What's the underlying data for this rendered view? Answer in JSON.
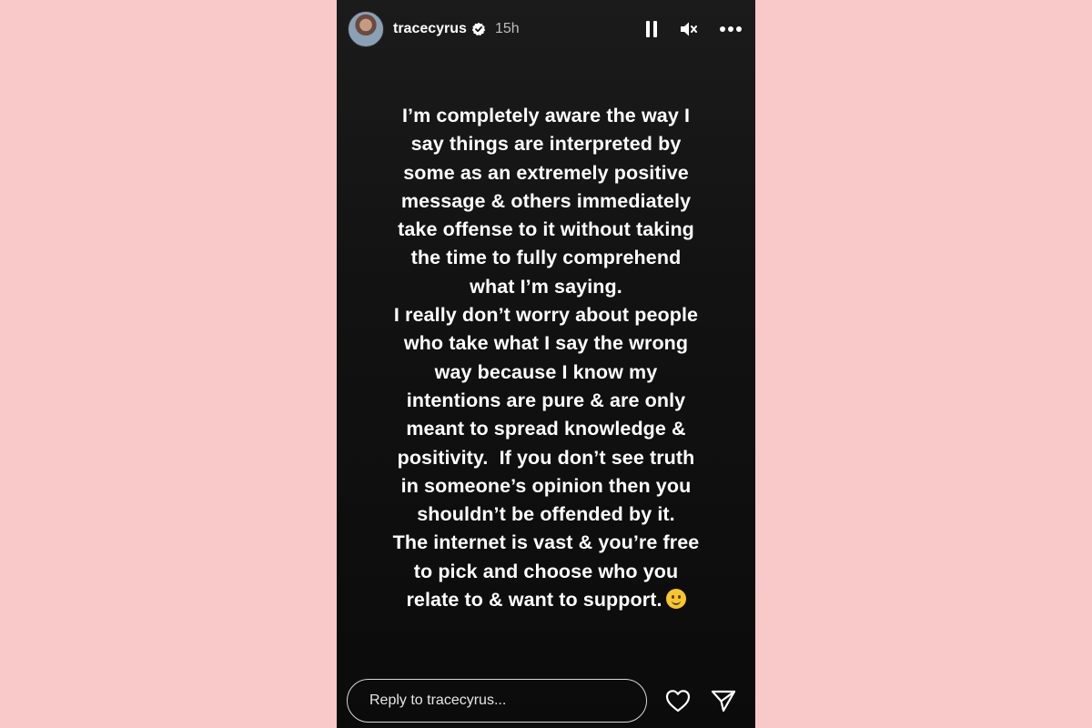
{
  "header": {
    "username": "tracecyrus",
    "verified_icon": "verified-badge-icon",
    "time": "15h",
    "icons": [
      "pause-icon",
      "muted-speaker-icon",
      "more-options-icon"
    ]
  },
  "story": {
    "lines": [
      "I’m completely aware the way I",
      "say things are interpreted by",
      "some as an extremely positive",
      "message & others immediately",
      "take offense to it without taking",
      "the time to fully comprehend",
      "what I’m saying.",
      "I really don’t worry about people",
      "who take what I say the wrong",
      "way because I know my",
      "intentions are pure & are only",
      "meant to spread knowledge &",
      "positivity.  If you don’t see truth",
      "in someone’s opinion then you",
      "shouldn’t be offended by it.",
      "The internet is vast & you’re free",
      "to pick and choose who you",
      "relate to & want to support."
    ],
    "end_emoji": "slightly-smiling-face-emoji"
  },
  "footer": {
    "reply_placeholder": "Reply to tracecyrus...",
    "icons": [
      "heart-icon",
      "send-icon"
    ]
  },
  "colors": {
    "page_background": "#f9c9ca",
    "story_background": "#121212",
    "text": "#ffffff"
  }
}
